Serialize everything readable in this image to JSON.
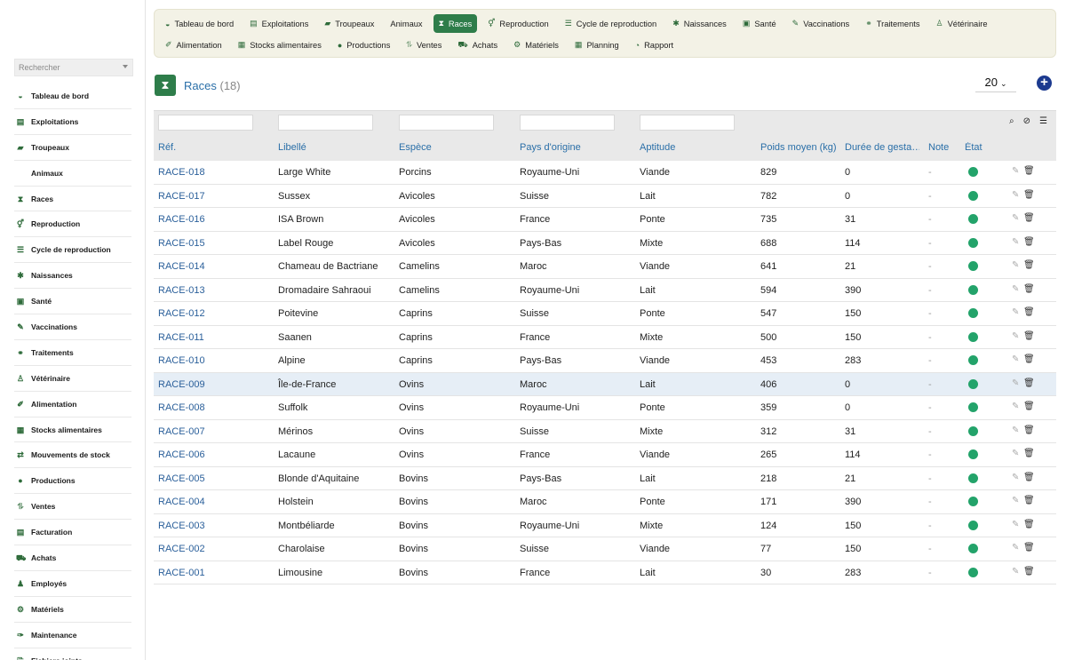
{
  "sidebar": {
    "search_placeholder": "Rechercher",
    "items": [
      {
        "label": "Tableau de bord",
        "icon": "dashboard-icon"
      },
      {
        "label": "Exploitations",
        "icon": "farm-icon"
      },
      {
        "label": "Troupeaux",
        "icon": "herd-icon"
      },
      {
        "label": "Animaux",
        "icon": ""
      },
      {
        "label": "Races",
        "icon": "hourglass-icon"
      },
      {
        "label": "Reproduction",
        "icon": "reproduction-icon"
      },
      {
        "label": "Cycle de reproduction",
        "icon": "list-icon"
      },
      {
        "label": "Naissances",
        "icon": "birth-icon"
      },
      {
        "label": "Santé",
        "icon": "health-icon"
      },
      {
        "label": "Vaccinations",
        "icon": "syringe-icon"
      },
      {
        "label": "Traitements",
        "icon": "pills-icon"
      },
      {
        "label": "Vétérinaire",
        "icon": "vet-icon"
      },
      {
        "label": "Alimentation",
        "icon": "feed-icon"
      },
      {
        "label": "Stocks alimentaires",
        "icon": "stock-icon"
      },
      {
        "label": "Mouvements de stock",
        "icon": "exchange-icon"
      },
      {
        "label": "Productions",
        "icon": "drop-icon"
      },
      {
        "label": "Ventes",
        "icon": "sales-icon"
      },
      {
        "label": "Facturation",
        "icon": "invoice-icon"
      },
      {
        "label": "Achats",
        "icon": "cart-icon"
      },
      {
        "label": "Employés",
        "icon": "employee-icon"
      },
      {
        "label": "Matériels",
        "icon": "equipment-icon"
      },
      {
        "label": "Maintenance",
        "icon": "wrench-icon"
      },
      {
        "label": "Fichiers joints",
        "icon": "attachment-icon"
      }
    ]
  },
  "topnav": {
    "row1": [
      {
        "label": "Tableau de bord",
        "icon": "dashboard-icon"
      },
      {
        "label": "Exploitations",
        "icon": "farm-icon"
      },
      {
        "label": "Troupeaux",
        "icon": "herd-icon"
      },
      {
        "label": "Animaux",
        "icon": ""
      },
      {
        "label": "Races",
        "icon": "hourglass-icon",
        "active": true
      },
      {
        "label": "Reproduction",
        "icon": "reproduction-icon"
      },
      {
        "label": "Cycle de reproduction",
        "icon": "list-icon"
      },
      {
        "label": "Naissances",
        "icon": "birth-icon"
      },
      {
        "label": "Santé",
        "icon": "health-icon"
      },
      {
        "label": "Vaccinations",
        "icon": "syringe-icon"
      },
      {
        "label": "Traitements",
        "icon": "pills-icon"
      },
      {
        "label": "Vétérinaire",
        "icon": "vet-icon"
      }
    ],
    "row2": [
      {
        "label": "Alimentation",
        "icon": "feed-icon"
      },
      {
        "label": "Stocks alimentaires",
        "icon": "stock-icon"
      },
      {
        "label": "Productions",
        "icon": "drop-icon"
      },
      {
        "label": "Ventes",
        "icon": "sales-icon"
      },
      {
        "label": "Achats",
        "icon": "cart-icon"
      },
      {
        "label": "Matériels",
        "icon": "equipment-icon"
      },
      {
        "label": "Planning",
        "icon": "calendar-icon"
      },
      {
        "label": "Rapport",
        "icon": "report-icon"
      }
    ]
  },
  "header": {
    "title": "Races",
    "count": "(18)",
    "per_page": "20"
  },
  "table": {
    "columns": [
      "Réf.",
      "Libellé",
      "Espèce",
      "Pays d'origine",
      "Aptitude",
      "Poids moyen (kg)",
      "Durée de gesta…",
      "Note",
      "État"
    ],
    "rows": [
      [
        "RACE-018",
        "Large White",
        "Porcins",
        "Royaume-Uni",
        "Viande",
        "829",
        "0",
        "-"
      ],
      [
        "RACE-017",
        "Sussex",
        "Avicoles",
        "Suisse",
        "Lait",
        "782",
        "0",
        "-"
      ],
      [
        "RACE-016",
        "ISA Brown",
        "Avicoles",
        "France",
        "Ponte",
        "735",
        "31",
        "-"
      ],
      [
        "RACE-015",
        "Label Rouge",
        "Avicoles",
        "Pays-Bas",
        "Mixte",
        "688",
        "114",
        "-"
      ],
      [
        "RACE-014",
        "Chameau de Bactriane",
        "Camelins",
        "Maroc",
        "Viande",
        "641",
        "21",
        "-"
      ],
      [
        "RACE-013",
        "Dromadaire Sahraoui",
        "Camelins",
        "Royaume-Uni",
        "Lait",
        "594",
        "390",
        "-"
      ],
      [
        "RACE-012",
        "Poitevine",
        "Caprins",
        "Suisse",
        "Ponte",
        "547",
        "150",
        "-"
      ],
      [
        "RACE-011",
        "Saanen",
        "Caprins",
        "France",
        "Mixte",
        "500",
        "150",
        "-"
      ],
      [
        "RACE-010",
        "Alpine",
        "Caprins",
        "Pays-Bas",
        "Viande",
        "453",
        "283",
        "-"
      ],
      [
        "RACE-009",
        "Île-de-France",
        "Ovins",
        "Maroc",
        "Lait",
        "406",
        "0",
        "-"
      ],
      [
        "RACE-008",
        "Suffolk",
        "Ovins",
        "Royaume-Uni",
        "Ponte",
        "359",
        "0",
        "-"
      ],
      [
        "RACE-007",
        "Mérinos",
        "Ovins",
        "Suisse",
        "Mixte",
        "312",
        "31",
        "-"
      ],
      [
        "RACE-006",
        "Lacaune",
        "Ovins",
        "France",
        "Viande",
        "265",
        "114",
        "-"
      ],
      [
        "RACE-005",
        "Blonde d'Aquitaine",
        "Bovins",
        "Pays-Bas",
        "Lait",
        "218",
        "21",
        "-"
      ],
      [
        "RACE-004",
        "Holstein",
        "Bovins",
        "Maroc",
        "Ponte",
        "171",
        "390",
        "-"
      ],
      [
        "RACE-003",
        "Montbéliarde",
        "Bovins",
        "Royaume-Uni",
        "Mixte",
        "124",
        "150",
        "-"
      ],
      [
        "RACE-002",
        "Charolaise",
        "Bovins",
        "Suisse",
        "Viande",
        "77",
        "150",
        "-"
      ],
      [
        "RACE-001",
        "Limousine",
        "Bovins",
        "France",
        "Lait",
        "30",
        "283",
        "-"
      ]
    ],
    "highlighted_row": 9,
    "status_color": "#23a36a"
  },
  "colors": {
    "accent": "#2e7d4a",
    "link": "#2a6fa8",
    "nav_bg": "#f3f2e6"
  }
}
